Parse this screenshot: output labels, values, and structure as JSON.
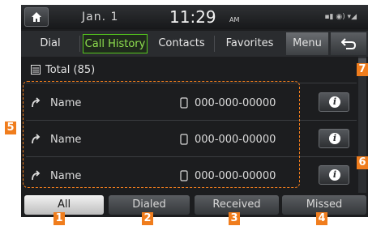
{
  "status_bar": {
    "date": "Jan.  1",
    "time": "11:29",
    "ampm": "AM",
    "status_icons": "▪▮ ◉) ▾◢"
  },
  "tabs": [
    {
      "label": "Dial",
      "active": false
    },
    {
      "label": "Call History",
      "active": true
    },
    {
      "label": "Contacts",
      "active": false
    },
    {
      "label": "Favorites",
      "active": false
    }
  ],
  "menu_label": "Menu",
  "total_label": "Total (85)",
  "call_list": [
    {
      "name": "Name",
      "number": "000-000-00000",
      "icon": "outgoing-call-icon"
    },
    {
      "name": "Name",
      "number": "000-000-00000",
      "icon": "outgoing-call-icon"
    },
    {
      "name": "Name",
      "number": "000-000-00000",
      "icon": "outgoing-call-icon"
    }
  ],
  "filters": [
    {
      "label": "All",
      "active": true
    },
    {
      "label": "Dialed",
      "active": false
    },
    {
      "label": "Received",
      "active": false
    },
    {
      "label": "Missed",
      "active": false
    }
  ],
  "callouts": [
    "1",
    "2",
    "3",
    "4",
    "5",
    "6",
    "7"
  ],
  "colors": {
    "accent_green": "#55c61e",
    "callout_orange": "#f07d1d",
    "screen_bg": "#1c1d1f"
  }
}
